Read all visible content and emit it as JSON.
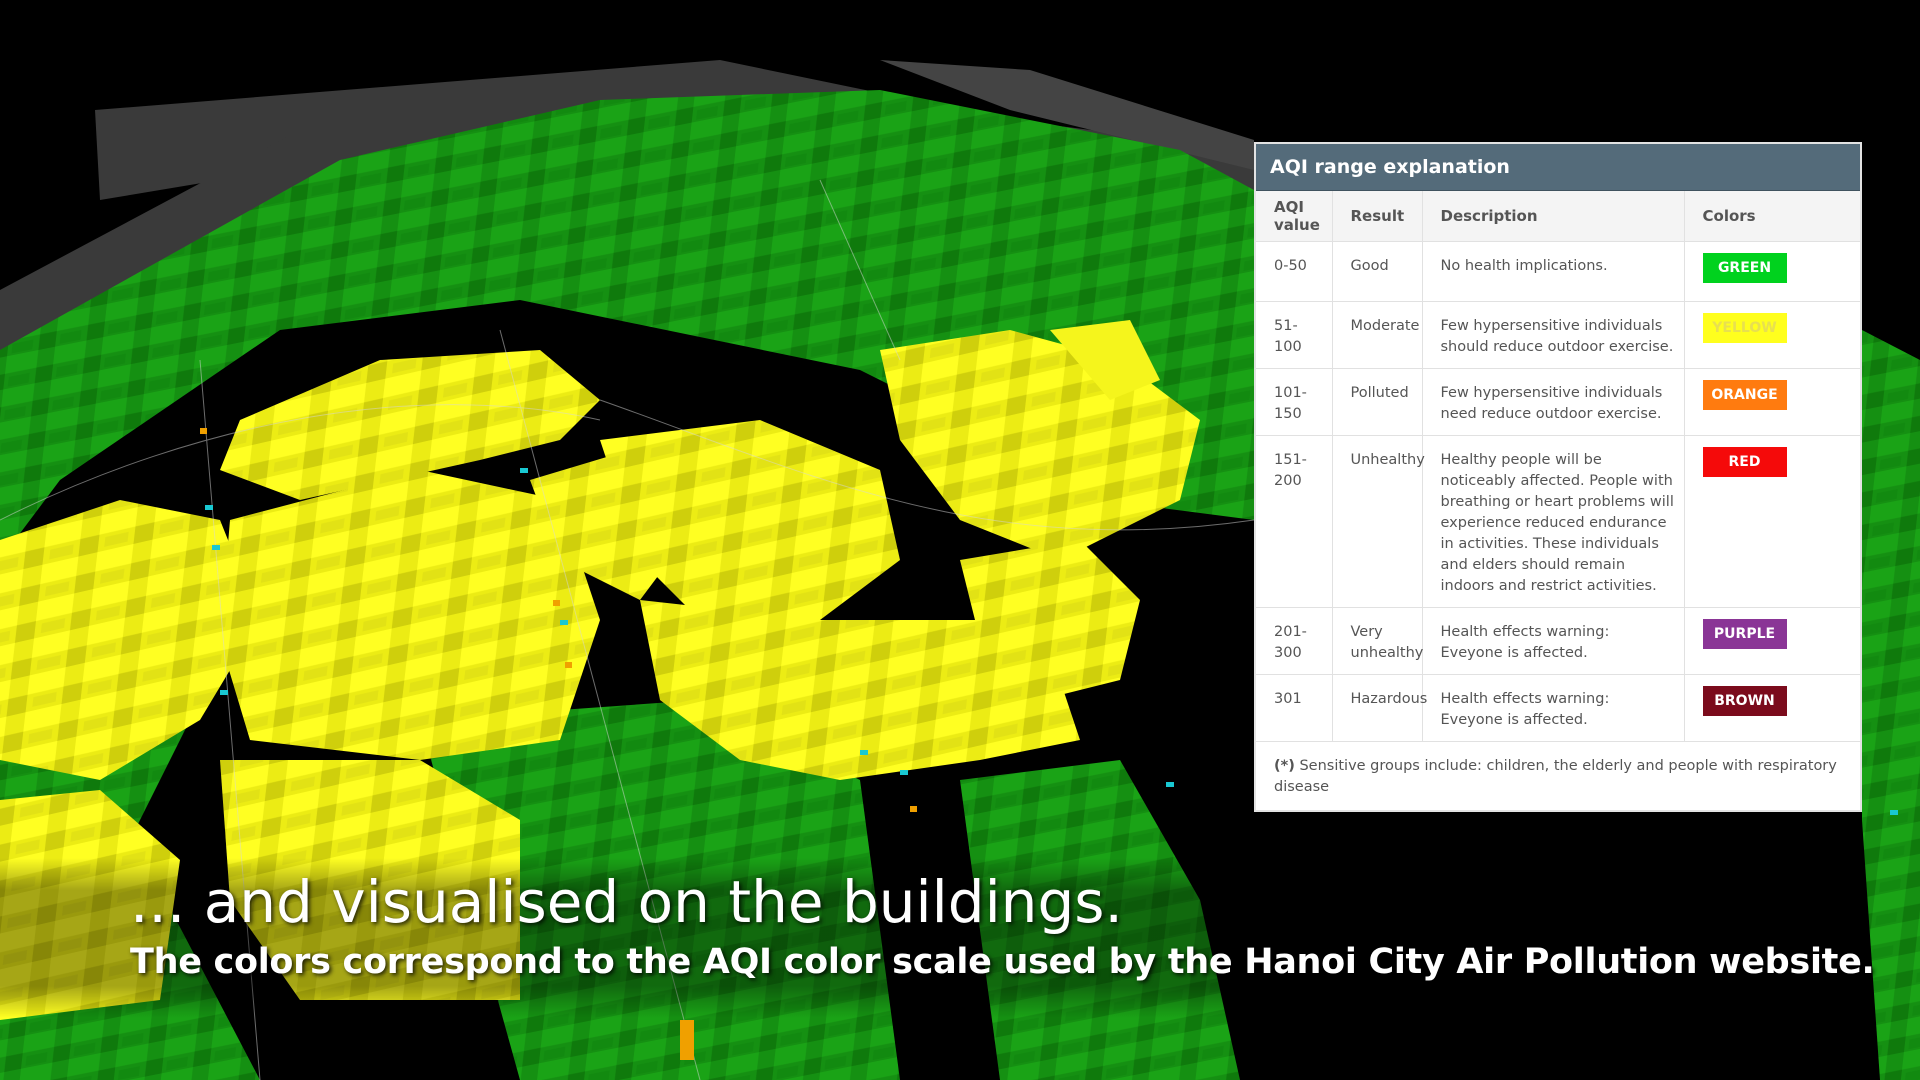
{
  "aqi_panel": {
    "title": "AQI range explanation",
    "headers": {
      "value": "AQI value",
      "result": "Result",
      "description": "Description",
      "colors": "Colors"
    },
    "rows": [
      {
        "value": "0-50",
        "result": "Good",
        "description": "No health implications.",
        "color_label": "GREEN",
        "color": "#00d21e",
        "text_color": "#ffffff"
      },
      {
        "value": "51-100",
        "result": "Moderate",
        "description": "Few hypersensitive individuals should reduce outdoor exercise.",
        "color_label": "YELLOW",
        "color": "#ffff1e",
        "text_color": "#e8e050"
      },
      {
        "value": "101-150",
        "result": "Polluted",
        "description": "Few hypersensitive individuals need reduce outdoor exercise.",
        "color_label": "ORANGE",
        "color": "#ff7b0f",
        "text_color": "#ffffff"
      },
      {
        "value": "151-200",
        "result": "Unhealthy",
        "description": "Healthy people will be noticeably affected. People with breathing or heart problems will experience reduced endurance in activities. These individuals and elders should remain indoors and restrict activities.",
        "color_label": "RED",
        "color": "#f50a0a",
        "text_color": "#ffffff"
      },
      {
        "value": "201-300",
        "result": "Very unhealthy",
        "description": "Health effects warning: Eveyone is affected.",
        "color_label": "PURPLE",
        "color": "#8a3596",
        "text_color": "#ffffff"
      },
      {
        "value": "301",
        "result": "Hazardous",
        "description": "Health effects warning: Eveyone is affected.",
        "color_label": "BROWN",
        "color": "#7b0b1c",
        "text_color": "#ffffff"
      }
    ],
    "footnote_marker": "(*)",
    "footnote_text": " Sensitive groups include: children, the elderly and people with respiratory disease"
  },
  "subtitles": {
    "line1": "... and visualised on the buildings.",
    "line2": "The colors correspond to the AQI color scale used by the Hanoi City Air Pollution website."
  },
  "scene_colors": {
    "good": "#1a9a12",
    "good_dark": "#0c6e08",
    "moderate": "#f2f21a",
    "moderate_dark": "#c8c80e",
    "road": "#3a3a3a",
    "sensor": "#19c8d2"
  }
}
